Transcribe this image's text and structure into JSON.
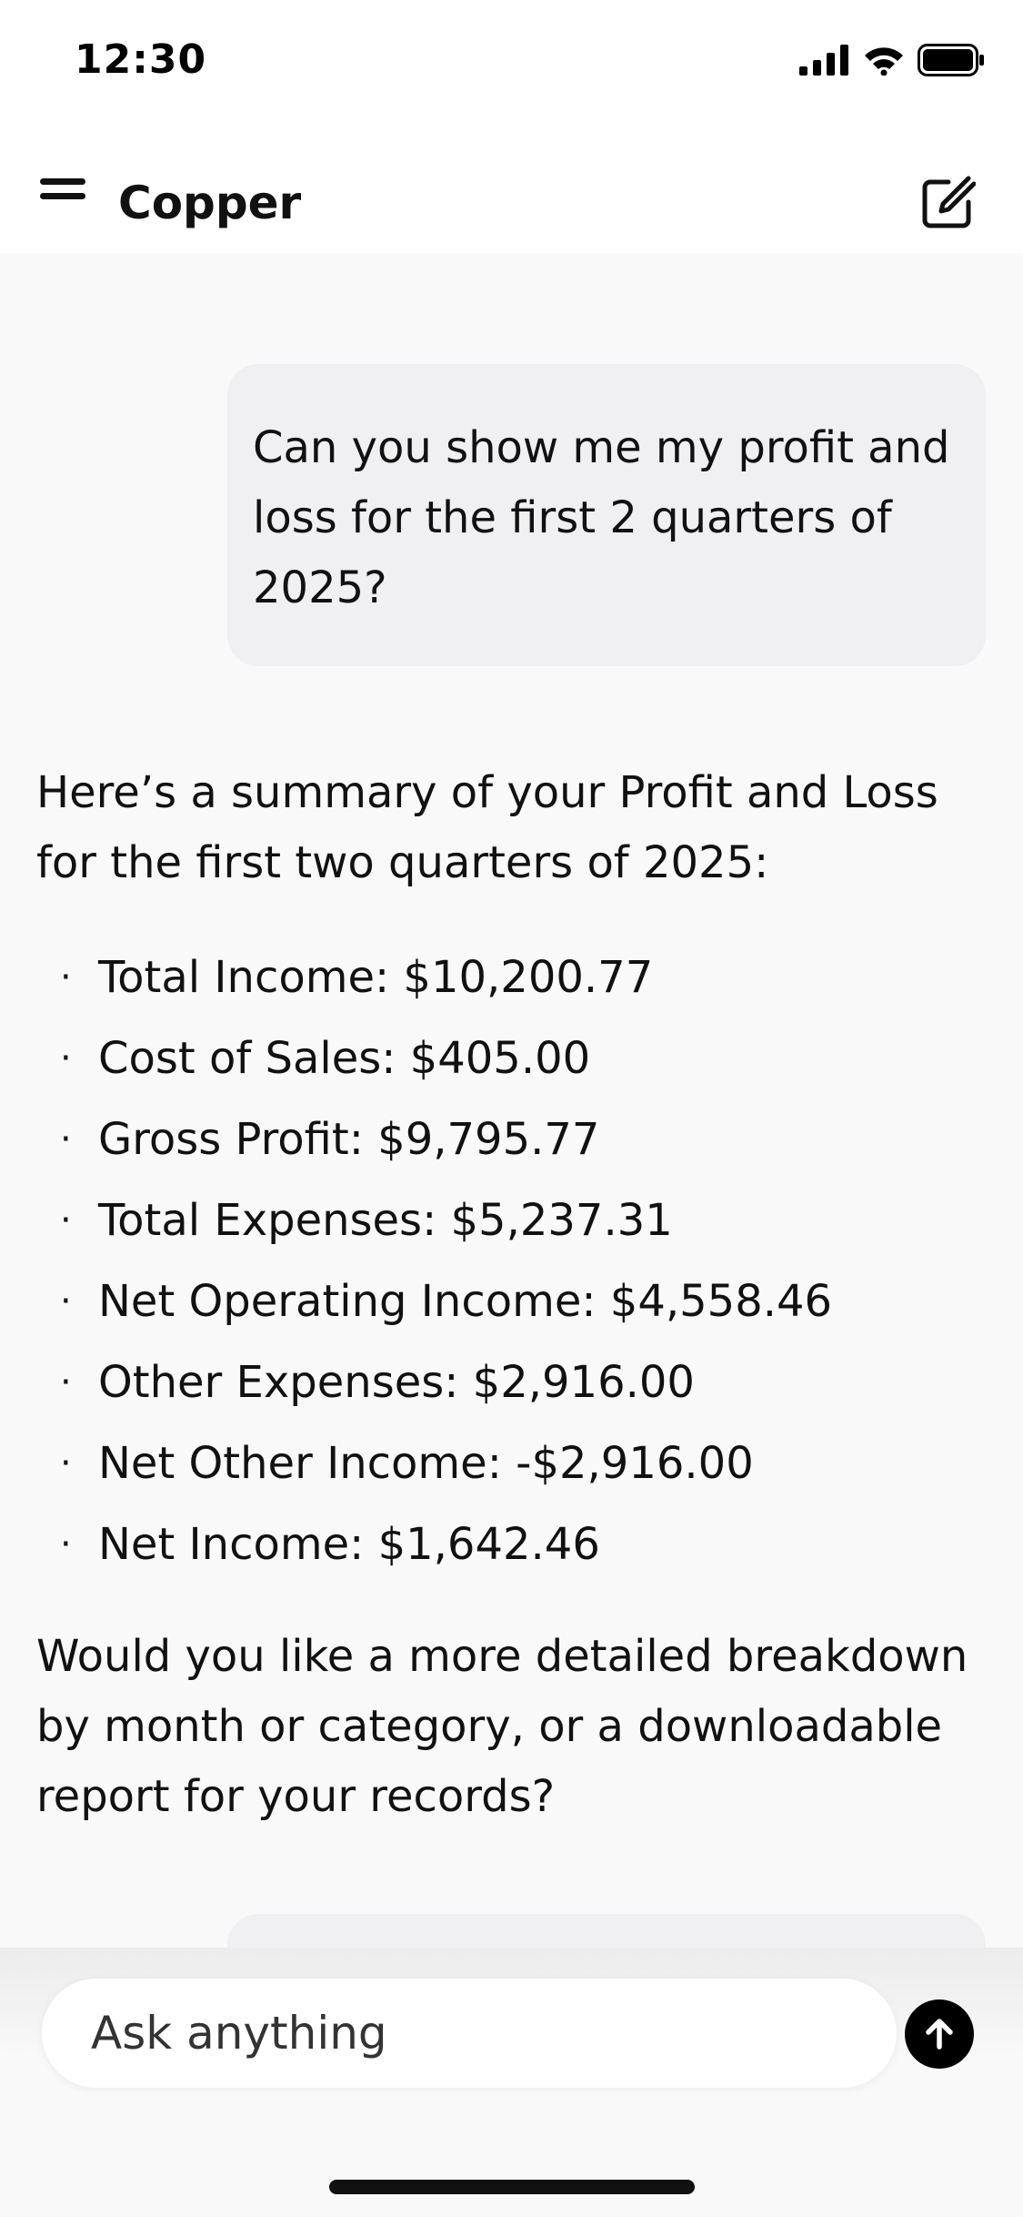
{
  "status_bar": {
    "time": "12:30",
    "icons": [
      "signal-icon",
      "wifi-icon",
      "battery-icon"
    ]
  },
  "header": {
    "title": "Copper",
    "menu_icon": "hamburger-menu-icon",
    "compose_icon": "new-chat-icon"
  },
  "conversation": {
    "user_message": "Can you show me my profit and loss for the first 2 quarters of 2025?",
    "assistant_intro": "Here’s a summary of your Profit and Loss for the first two quarters of 2025:",
    "summary_items": [
      "Total Income: $10,200.77",
      "Cost of Sales: $405.00",
      "Gross Profit: $9,795.77",
      "Total Expenses: $5,237.31",
      "Net Operating Income: $4,558.46",
      "Other Expenses: $2,916.00",
      "Net Other Income: -$2,916.00",
      "Net Income: $1,642.46"
    ],
    "assistant_followup": "Would you like a more detailed breakdown by month or category, or a downloadable report for your records?"
  },
  "composer": {
    "placeholder": "Ask anything",
    "value": "",
    "send_icon": "arrow-up-icon"
  },
  "colors": {
    "background": "#f9f9fa",
    "user_bubble": "#f0f0f2",
    "header": "#ffffff",
    "send_button": "#000000"
  }
}
